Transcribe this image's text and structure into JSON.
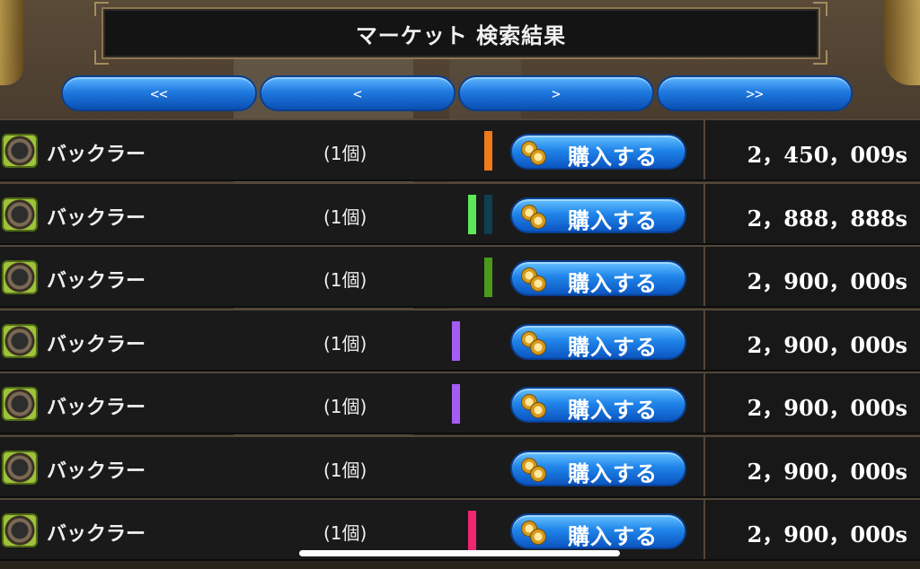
{
  "header": {
    "title": "マーケット 検索結果"
  },
  "nav": {
    "first_label": "<<",
    "prev_label": "<",
    "next_label": ">",
    "last_label": ">>"
  },
  "buy_label": "購入する",
  "rows": [
    {
      "name": "バックラー",
      "qty": "(1個)",
      "price": "2，450，009s",
      "bars": [
        "#f07a1a"
      ]
    },
    {
      "name": "バックラー",
      "qty": "(1個)",
      "price": "2，888，888s",
      "bars": [
        "#5de85a",
        "#0f3e4f"
      ]
    },
    {
      "name": "バックラー",
      "qty": "(1個)",
      "price": "2，900，000s",
      "bars": [
        "#4a9a1c"
      ]
    },
    {
      "name": "バックラー",
      "qty": "(1個)",
      "price": "2，900，000s",
      "bars": [
        "#a45cf5"
      ]
    },
    {
      "name": "バックラー",
      "qty": "(1個)",
      "price": "2，900，000s",
      "bars": [
        "#a45cf5"
      ]
    },
    {
      "name": "バックラー",
      "qty": "(1個)",
      "price": "2，900，000s",
      "bars": []
    },
    {
      "name": "バックラー",
      "qty": "(1個)",
      "price": "2，900，000s",
      "bars": [
        "#f0266f"
      ]
    }
  ]
}
